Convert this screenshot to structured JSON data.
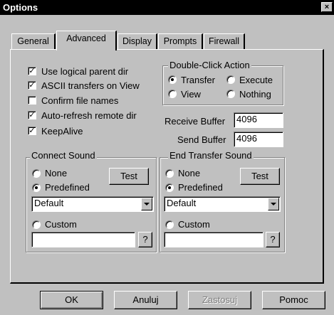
{
  "window": {
    "title": "Options",
    "close_glyph": "×"
  },
  "tabs": [
    {
      "label": "General"
    },
    {
      "label": "Advanced"
    },
    {
      "label": "Display"
    },
    {
      "label": "Prompts"
    },
    {
      "label": "Firewall"
    }
  ],
  "active_tab": "Advanced",
  "checkboxes": [
    {
      "label": "Use logical parent dir",
      "checked": true
    },
    {
      "label": "ASCII transfers on View",
      "checked": true
    },
    {
      "label": "Confirm file names",
      "checked": false
    },
    {
      "label": "Auto-refresh remote dir",
      "checked": true
    },
    {
      "label": "KeepAlive",
      "checked": true
    }
  ],
  "check_glyph": "✓",
  "double_click": {
    "title": "Double-Click Action",
    "options": [
      {
        "label": "Transfer",
        "selected": true
      },
      {
        "label": "Execute",
        "selected": false
      },
      {
        "label": "View",
        "selected": false
      },
      {
        "label": "Nothing",
        "selected": false
      }
    ]
  },
  "receive_buffer": {
    "label": "Receive Buffer",
    "value": "4096"
  },
  "send_buffer": {
    "label": "Send Buffer",
    "value": "4096"
  },
  "connect_sound": {
    "title": "Connect Sound",
    "none_label": "None",
    "predefined_label": "Predefined",
    "selected": "Predefined",
    "test_label": "Test",
    "dropdown_value": "Default",
    "custom_label": "Custom",
    "custom_value": "",
    "browse_label": "?"
  },
  "end_sound": {
    "title": "End Transfer Sound",
    "none_label": "None",
    "predefined_label": "Predefined",
    "selected": "Predefined",
    "test_label": "Test",
    "dropdown_value": "Default",
    "custom_label": "Custom",
    "custom_value": "",
    "browse_label": "?"
  },
  "buttons": {
    "ok": "OK",
    "cancel": "Anuluj",
    "apply": "Zastosuj",
    "help": "Pomoc"
  }
}
